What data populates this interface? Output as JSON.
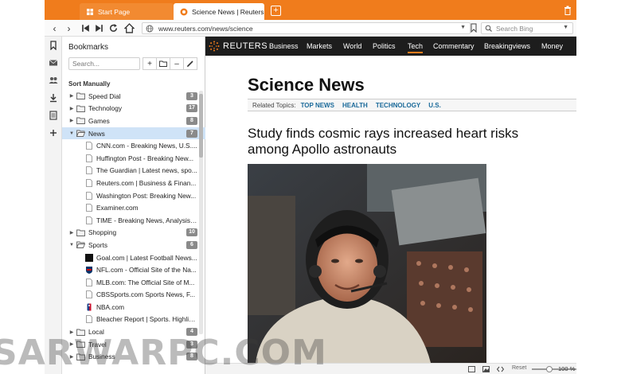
{
  "tabs": [
    {
      "title": "Start Page",
      "active": false
    },
    {
      "title": "Science News | Reuters.com",
      "active": true
    }
  ],
  "address": {
    "url": "www.reuters.com/news/science",
    "search_placeholder": "Search Bing"
  },
  "bookmarks": {
    "title": "Bookmarks",
    "search_placeholder": "Search...",
    "sort_label": "Sort Manually",
    "items": [
      {
        "label": "Speed Dial",
        "count": "3",
        "type": "folder"
      },
      {
        "label": "Technology",
        "count": "17",
        "type": "folder"
      },
      {
        "label": "Games",
        "count": "8",
        "type": "folder"
      },
      {
        "label": "News",
        "count": "7",
        "type": "folder-open",
        "selected": true
      },
      {
        "label": "CNN.com - Breaking News, U.S....",
        "type": "page"
      },
      {
        "label": "Huffington Post - Breaking New...",
        "type": "page"
      },
      {
        "label": "The Guardian | Latest news, spo...",
        "type": "page"
      },
      {
        "label": "Reuters.com | Business & Finan...",
        "type": "page"
      },
      {
        "label": "Washington Post: Breaking New...",
        "type": "page"
      },
      {
        "label": "Examiner.com",
        "type": "page"
      },
      {
        "label": "TIME - Breaking News, Analysis,...",
        "type": "page"
      },
      {
        "label": "Shopping",
        "count": "10",
        "type": "folder"
      },
      {
        "label": "Sports",
        "count": "6",
        "type": "folder-open"
      },
      {
        "label": "Goal.com | Latest Football News...",
        "type": "fav",
        "fav": "goal"
      },
      {
        "label": "NFL.com - Official Site of the Na...",
        "type": "fav",
        "fav": "nfl"
      },
      {
        "label": "MLB.com: The Official Site of M...",
        "type": "page"
      },
      {
        "label": "CBSSports.com Sports News, F...",
        "type": "page"
      },
      {
        "label": "NBA.com",
        "type": "fav",
        "fav": "nba"
      },
      {
        "label": "Bleacher Report | Sports. Highlig...",
        "type": "page"
      },
      {
        "label": "Local",
        "count": "4",
        "type": "folder"
      },
      {
        "label": "Travel",
        "count": "3",
        "type": "folder"
      },
      {
        "label": "Business",
        "count": "8",
        "type": "folder"
      }
    ]
  },
  "site": {
    "brand": "REUTERS",
    "nav": [
      "Business",
      "Markets",
      "World",
      "Politics",
      "Tech",
      "Commentary",
      "Breakingviews",
      "Money"
    ],
    "active_nav": "Tech",
    "section_title": "Science News",
    "topics_label": "Related Topics:",
    "topics": [
      "TOP NEWS",
      "HEALTH",
      "TECHNOLOGY",
      "U.S."
    ],
    "headline": "Study finds cosmic rays increased heart risks among Apollo astronauts"
  },
  "status": {
    "reset_label": "Reset",
    "zoom": "100 %"
  },
  "watermark": "SARWARPC.COM",
  "colors": {
    "accent": "#f07c1c",
    "selection": "#cfe3f7",
    "nav_bg": "#1d1d1d",
    "link": "#1a6a9a"
  }
}
